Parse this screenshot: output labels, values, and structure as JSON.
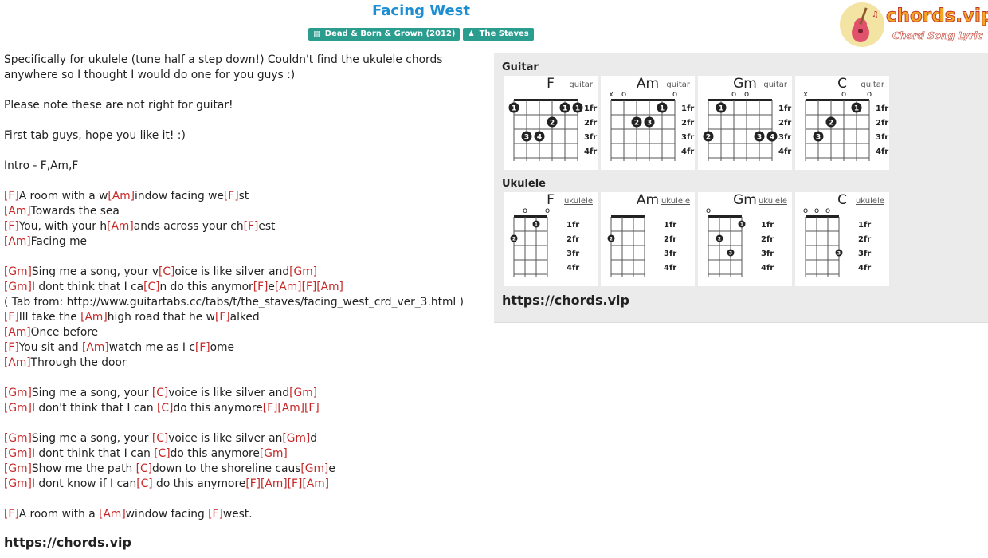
{
  "header": {
    "title": "Facing West",
    "album_badge": "Dead & Born & Grown (2012)",
    "artist_badge": "The Staves",
    "logo_text": "chords.vip",
    "logo_sub": "Chord Song Lyric"
  },
  "lyrics": [
    [
      {
        "t": "Specifically for ukulele (tune half a step down!) Couldn't find the ukulele chords"
      }
    ],
    [
      {
        "t": "anywhere so I thought I would do one for you guys :)"
      }
    ],
    [],
    [
      {
        "t": "Please note these are not right for guitar!"
      }
    ],
    [],
    [
      {
        "t": "First tab guys, hope you like it! :)"
      }
    ],
    [],
    [
      {
        "t": "Intro - F,Am,F"
      }
    ],
    [],
    [
      {
        "c": "[F]"
      },
      {
        "t": "A room with a w"
      },
      {
        "c": "[Am]"
      },
      {
        "t": "indow facing we"
      },
      {
        "c": "[F]"
      },
      {
        "t": "st"
      }
    ],
    [
      {
        "c": "[Am]"
      },
      {
        "t": "Towards the sea"
      }
    ],
    [
      {
        "c": "[F]"
      },
      {
        "t": "You, with your h"
      },
      {
        "c": "[Am]"
      },
      {
        "t": "ands across your ch"
      },
      {
        "c": "[F]"
      },
      {
        "t": "est"
      }
    ],
    [
      {
        "c": "[Am]"
      },
      {
        "t": "Facing me"
      }
    ],
    [],
    [
      {
        "c": "[Gm]"
      },
      {
        "t": "Sing me a song, your v"
      },
      {
        "c": "[C]"
      },
      {
        "t": "oice is like silver and"
      },
      {
        "c": "[Gm]"
      }
    ],
    [
      {
        "c": "[Gm]"
      },
      {
        "t": "I dont think that I ca"
      },
      {
        "c": "[C]"
      },
      {
        "t": "n do this anymor"
      },
      {
        "c": "[F]"
      },
      {
        "t": "e"
      },
      {
        "c": "[Am]"
      },
      {
        "c": "[F]"
      },
      {
        "c": "[Am]"
      }
    ],
    [
      {
        "t": "( Tab from: http://www.guitartabs.cc/tabs/t/the_staves/facing_west_crd_ver_3.html )"
      }
    ],
    [
      {
        "c": "[F]"
      },
      {
        "t": "Ill take the "
      },
      {
        "c": "[Am]"
      },
      {
        "t": "high road that he w"
      },
      {
        "c": "[F]"
      },
      {
        "t": "alked"
      }
    ],
    [
      {
        "c": "[Am]"
      },
      {
        "t": "Once before"
      }
    ],
    [
      {
        "c": "[F]"
      },
      {
        "t": "You sit and "
      },
      {
        "c": "[Am]"
      },
      {
        "t": "watch me as I c"
      },
      {
        "c": "[F]"
      },
      {
        "t": "ome"
      }
    ],
    [
      {
        "c": "[Am]"
      },
      {
        "t": "Through the door"
      }
    ],
    [],
    [
      {
        "c": "[Gm]"
      },
      {
        "t": "Sing me a song, your "
      },
      {
        "c": "[C]"
      },
      {
        "t": "voice is like silver and"
      },
      {
        "c": "[Gm]"
      }
    ],
    [
      {
        "c": "[Gm]"
      },
      {
        "t": "I don't think that I can "
      },
      {
        "c": "[C]"
      },
      {
        "t": "do this anymore"
      },
      {
        "c": "[F]"
      },
      {
        "c": "[Am]"
      },
      {
        "c": "[F]"
      }
    ],
    [],
    [
      {
        "c": "[Gm]"
      },
      {
        "t": "Sing me a song, your "
      },
      {
        "c": "[C]"
      },
      {
        "t": "voice is like silver an"
      },
      {
        "c": "[Gm]"
      },
      {
        "t": "d"
      }
    ],
    [
      {
        "c": "[Gm]"
      },
      {
        "t": "I dont think that I can "
      },
      {
        "c": "[C]"
      },
      {
        "t": "do this anymore"
      },
      {
        "c": "[Gm]"
      }
    ],
    [
      {
        "c": "[Gm]"
      },
      {
        "t": "Show me the path "
      },
      {
        "c": "[C]"
      },
      {
        "t": "down to the shoreline caus"
      },
      {
        "c": "[Gm]"
      },
      {
        "t": "e"
      }
    ],
    [
      {
        "c": "[Gm]"
      },
      {
        "t": "I dont know if I can"
      },
      {
        "c": "[C]"
      },
      {
        "t": " do this anymore"
      },
      {
        "c": "[F]"
      },
      {
        "c": "[Am]"
      },
      {
        "c": "[F]"
      },
      {
        "c": "[Am]"
      }
    ],
    [],
    [
      {
        "c": "[F]"
      },
      {
        "t": "A room with a "
      },
      {
        "c": "[Am]"
      },
      {
        "t": "window facing "
      },
      {
        "c": "[F]"
      },
      {
        "t": "west."
      }
    ]
  ],
  "footer_url": "https://chords.vip",
  "panel": {
    "guitar_label": "Guitar",
    "ukulele_label": "Ukulele",
    "url": "https://chords.vip",
    "fret_labels": [
      "1fr",
      "2fr",
      "3fr",
      "4fr"
    ],
    "guitar": [
      {
        "name": "F",
        "link": "guitar",
        "top": [
          "",
          "",
          "",
          "",
          "",
          ""
        ],
        "dots": [
          {
            "s": 0,
            "f": 1,
            "n": "1"
          },
          {
            "s": 4,
            "f": 1,
            "n": "1"
          },
          {
            "s": 5,
            "f": 1,
            "n": "1"
          },
          {
            "s": 3,
            "f": 2,
            "n": "2"
          },
          {
            "s": 1,
            "f": 3,
            "n": "3"
          },
          {
            "s": 2,
            "f": 3,
            "n": "4"
          }
        ]
      },
      {
        "name": "Am",
        "link": "guitar",
        "top": [
          "x",
          "o",
          "",
          "",
          "",
          "o"
        ],
        "dots": [
          {
            "s": 4,
            "f": 1,
            "n": "1"
          },
          {
            "s": 2,
            "f": 2,
            "n": "2"
          },
          {
            "s": 3,
            "f": 2,
            "n": "3"
          }
        ]
      },
      {
        "name": "Gm",
        "link": "guitar",
        "top": [
          "",
          "",
          "o",
          "o",
          "",
          ""
        ],
        "dots": [
          {
            "s": 1,
            "f": 1,
            "n": "1"
          },
          {
            "s": 0,
            "f": 3,
            "n": "2"
          },
          {
            "s": 4,
            "f": 3,
            "n": "3"
          },
          {
            "s": 5,
            "f": 3,
            "n": "4"
          }
        ]
      },
      {
        "name": "C",
        "link": "guitar",
        "top": [
          "x",
          "",
          "",
          "o",
          "",
          "o"
        ],
        "dots": [
          {
            "s": 4,
            "f": 1,
            "n": "1"
          },
          {
            "s": 2,
            "f": 2,
            "n": "2"
          },
          {
            "s": 1,
            "f": 3,
            "n": "3"
          }
        ]
      }
    ],
    "ukulele": [
      {
        "name": "F",
        "link": "ukulele",
        "top": [
          "",
          "o",
          "",
          "o"
        ],
        "dots": [
          {
            "s": 2,
            "f": 1,
            "n": "1"
          },
          {
            "s": 0,
            "f": 2,
            "n": "2"
          }
        ]
      },
      {
        "name": "Am",
        "link": "ukulele",
        "top": [
          "",
          "",
          "",
          ""
        ],
        "dots": [
          {
            "s": 0,
            "f": 2,
            "n": "2"
          }
        ]
      },
      {
        "name": "Gm",
        "link": "ukulele",
        "top": [
          "o",
          "",
          "",
          ""
        ],
        "dots": [
          {
            "s": 3,
            "f": 1,
            "n": "1"
          },
          {
            "s": 1,
            "f": 2,
            "n": "2"
          },
          {
            "s": 2,
            "f": 3,
            "n": "3"
          }
        ]
      },
      {
        "name": "C",
        "link": "ukulele",
        "top": [
          "o",
          "o",
          "o",
          ""
        ],
        "dots": [
          {
            "s": 3,
            "f": 3,
            "n": "3"
          }
        ]
      }
    ]
  }
}
